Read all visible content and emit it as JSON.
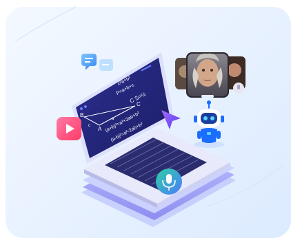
{
  "illustration": {
    "screen_formulas": {
      "line1": "c²a+b²",
      "line2": "P=a+b+c",
      "line3": "C S=½",
      "line4": "(a+b)²=a²+2ab+b²",
      "line5": "(a-b)²=a²-2ab+b²"
    },
    "vertex_labels": {
      "b": "B",
      "a": "A",
      "c": "C"
    },
    "side_labels": {
      "left": "c",
      "bottom": "a"
    },
    "icons": {
      "play": "play-icon",
      "microphone": "microphone-icon",
      "chat": "chat-bubbles-icon",
      "cursor": "cursor-arrow-icon",
      "robot": "robot-assistant-icon",
      "portraits": "portrait-cards-icon"
    },
    "colors": {
      "laptop_screen": "#23247a",
      "laptop_body": "#dcdcf4",
      "accent_purple": "#6b4cf6",
      "play_gradient_start": "#ff6f9c",
      "play_gradient_end": "#ff3d6b",
      "robot_blue": "#1a6dff"
    }
  }
}
